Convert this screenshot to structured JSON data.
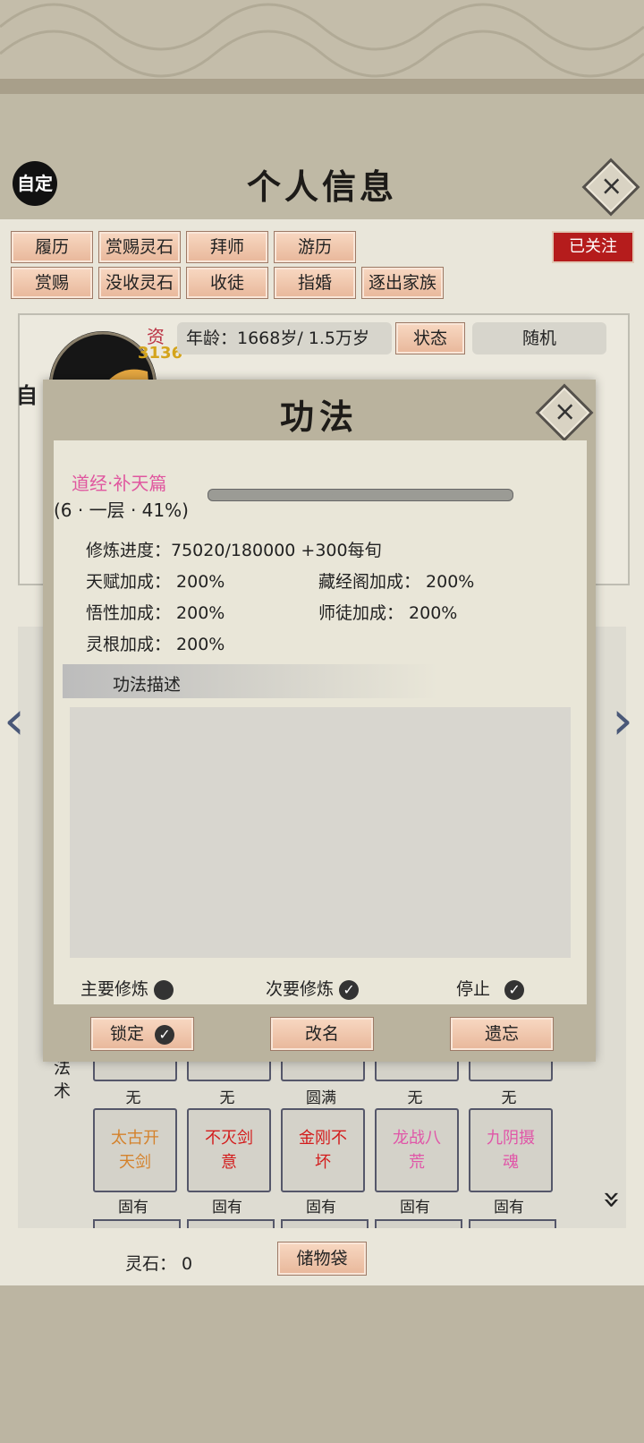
{
  "header": {
    "title": "个人信息",
    "custom_label": "自定",
    "close_icon": "×"
  },
  "actions": {
    "row1": [
      "履历",
      "赏赐灵石",
      "拜师",
      "游历"
    ],
    "row2": [
      "赏赐",
      "没收灵石",
      "收徒",
      "指婚",
      "逐出家族"
    ],
    "follow": "已关注"
  },
  "profile": {
    "badge_char": "资",
    "badge_value": "3136",
    "side_char": "自",
    "age": "年龄：1668岁/ 1.5万岁",
    "status_btn": "状态",
    "random_btn": "随机"
  },
  "dialog": {
    "title": "功法",
    "technique_name": "道经·补天篇",
    "level_text": "(6 · 一层 · 41%)",
    "progress": 0.41,
    "training": "修炼进度：75020/180000  +300每旬",
    "talent": "天赋加成：  200%",
    "library": "藏经阁加成：  200%",
    "insight": "悟性加成：  200%",
    "mentor": "师徒加成：     200%",
    "root": "灵根加成：  200%",
    "desc_header": "功法描述",
    "main_label": "主要修炼",
    "secondary_label": "次要修炼",
    "stop_label": "停止",
    "lock_btn": "锁定",
    "rename_btn": "改名",
    "forget_btn": "遗忘",
    "check": "✓"
  },
  "skills": {
    "side_label_1": "法",
    "side_label_2": "术",
    "top_labels": [
      "无",
      "无",
      "圆满",
      "无",
      "无"
    ],
    "items": [
      {
        "name1": "太古开",
        "name2": "天剑",
        "color": "#d4822c"
      },
      {
        "name1": "不灭剑",
        "name2": "意",
        "color": "#d31c1c"
      },
      {
        "name1": "金刚不",
        "name2": "坏",
        "color": "#d31c1c"
      },
      {
        "name1": "龙战八",
        "name2": "荒",
        "color": "#e056a8"
      },
      {
        "name1": "九阴摄",
        "name2": "魂",
        "color": "#e056a8"
      }
    ],
    "bottom_labels": [
      "固有",
      "固有",
      "固有",
      "固有",
      "固有"
    ]
  },
  "footer": {
    "stones": "灵石：  0",
    "bag_btn": "储物袋"
  },
  "nav": {
    "left": "‹",
    "right": "›",
    "more": "»"
  }
}
